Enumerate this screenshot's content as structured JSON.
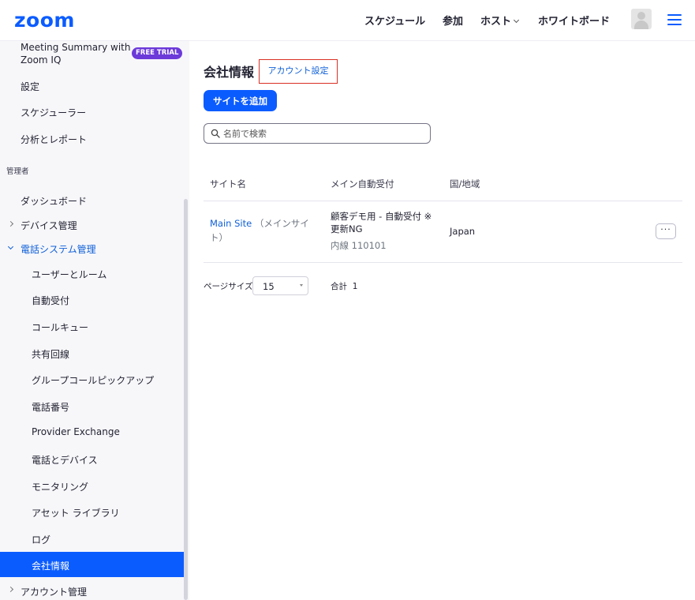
{
  "header": {
    "logo": "zoom",
    "nav": {
      "schedule": "スケジュール",
      "join": "参加",
      "host": "ホスト",
      "whiteboard": "ホワイトボード"
    },
    "icons": {
      "avatar": "user-avatar-icon",
      "menu": "hamburger-menu-icon",
      "host_dropdown": "chevron-down-icon"
    }
  },
  "sidebar": {
    "summary_label": "Meeting Summary with Zoom IQ",
    "trial_badge": "FREE TRIAL",
    "items_top": [
      "設定",
      "スケジューラー",
      "分析とレポート"
    ],
    "admin_section": "管理者",
    "dashboard": "ダッシュボード",
    "device_mgmt": "デバイス管理",
    "phone_mgmt": "電話システム管理",
    "phone_sub": [
      "ユーザーとルーム",
      "自動受付",
      "コールキュー",
      "共有回線",
      "グループコールピックアップ",
      "電話番号",
      "Provider Exchange",
      "電話とデバイス",
      "モニタリング",
      "アセット ライブラリ",
      "ログ"
    ],
    "active": "会社情報",
    "account_mgmt": "アカウント管理"
  },
  "main": {
    "title": "会社情報",
    "account_settings_link": "アカウント設定",
    "add_site_button": "サイトを追加",
    "search_placeholder": "名前で検索",
    "columns": [
      "サイト名",
      "メイン自動受付",
      "国/地域"
    ],
    "rows": [
      {
        "site_name": "Main Site",
        "site_note": "（メインサイト）",
        "auto_receptionist": "顧客デモ用 - 自動受付 ※更新NG",
        "extension": "内線 110101",
        "country": "Japan",
        "more": "···"
      }
    ],
    "pagination": {
      "page_size_label": "ページサイズ",
      "page_size_value": "15",
      "total_label": "合計",
      "total_value": "1"
    }
  }
}
